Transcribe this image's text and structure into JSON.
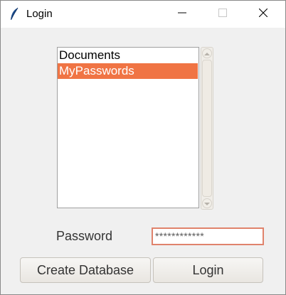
{
  "window": {
    "title": "Login",
    "app_icon": "feather-icon",
    "controls": [
      "minimize-icon",
      "maximize-icon",
      "close-icon"
    ]
  },
  "listbox": {
    "items": [
      {
        "label": "Documents",
        "selected": false
      },
      {
        "label": "MyPasswords",
        "selected": true
      }
    ],
    "selection_color": "#f07444"
  },
  "password": {
    "label": "Password",
    "value": "************"
  },
  "buttons": {
    "create_database": "Create Database",
    "login": "Login"
  }
}
